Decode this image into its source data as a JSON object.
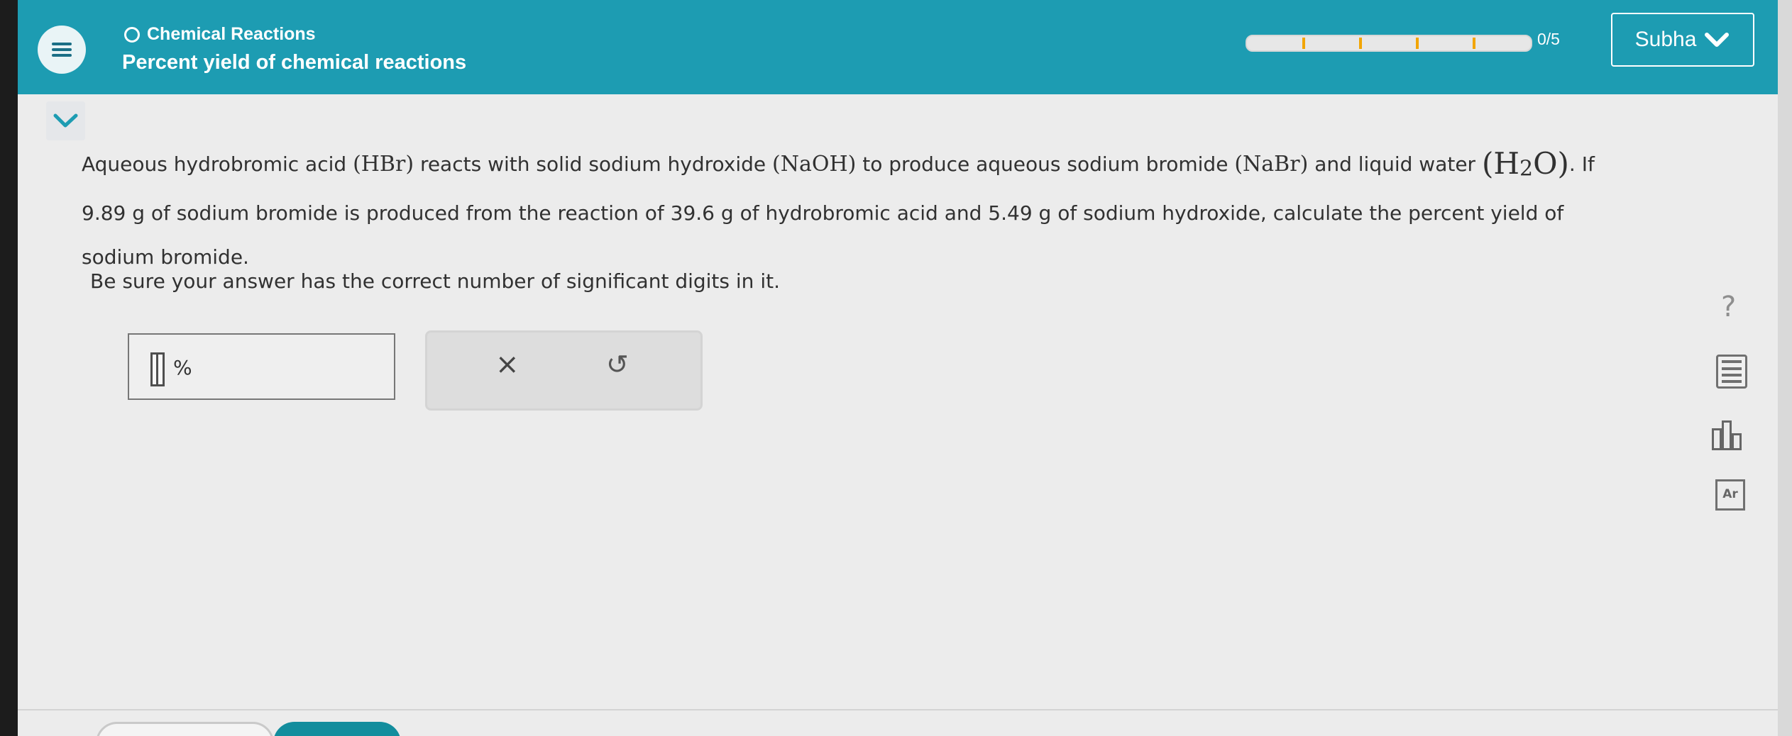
{
  "header": {
    "topic": "Chemical Reactions",
    "title": "Percent yield of chemical reactions",
    "progress_value": 0.0,
    "progress_text": "0/5",
    "user_name": "Subha"
  },
  "question": {
    "intro": "Aqueous hydrobromic acid",
    "hbr": "(HBr)",
    "text_after_hbr": "reacts with solid sodium hydroxide",
    "naoh": "(NaOH)",
    "text_after_naoh": "to produce aqueous sodium bromide",
    "nabr": "(NaBr)",
    "text_after_nabr": "and liquid water",
    "water_open": "(H",
    "water_sub": "2",
    "water_close": "O)",
    "line1_end": ". If",
    "line2": "9.89 g of sodium bromide is produced from the reaction of 39.6 g of hydrobromic acid and 5.49 g of sodium hydroxide, calculate the percent yield of",
    "line3": "sodium bromide.",
    "note": "Be sure your answer has the correct number of significant digits in it."
  },
  "answer": {
    "unit": "%"
  },
  "actions": {
    "clear_label": "×",
    "undo_label": "↺"
  },
  "tools": {
    "help_label": "?",
    "periodic_label": "Ar"
  },
  "colors": {
    "header": "#1d9cb2",
    "progress_marker": "#f2a500"
  },
  "icons": {
    "menu": "hamburger-icon",
    "topic": "circle-icon",
    "user": "chevron-down-icon",
    "collapse": "chevron-down-icon",
    "clear": "close-icon",
    "undo": "undo-icon",
    "calculator": "calculator-icon",
    "data": "bar-chart-icon",
    "periodic": "periodic-table-icon"
  }
}
